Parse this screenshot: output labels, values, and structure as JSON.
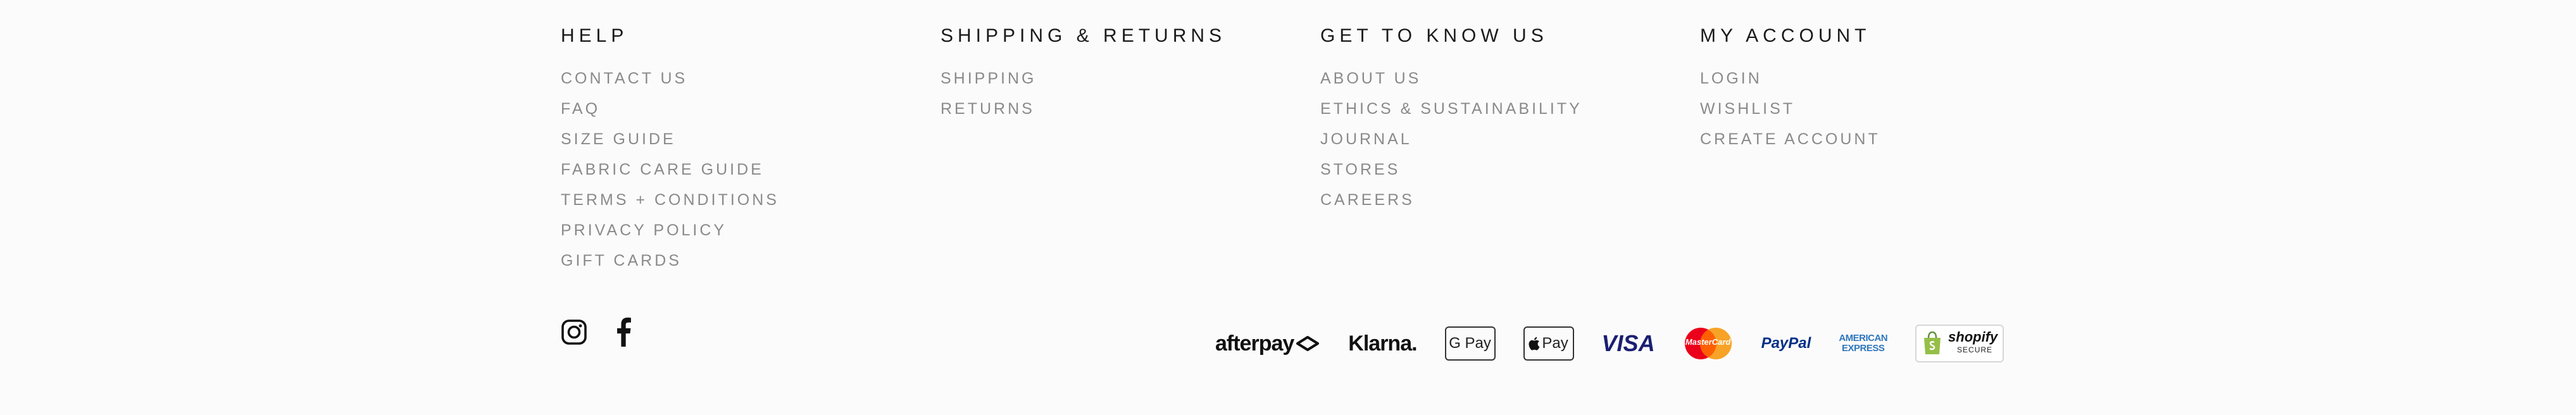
{
  "footer": {
    "columns": [
      {
        "heading": "HELP",
        "links": [
          "CONTACT US",
          "FAQ",
          "SIZE GUIDE",
          "FABRIC CARE GUIDE",
          "TERMS + CONDITIONS",
          "PRIVACY POLICY",
          "GIFT CARDS"
        ]
      },
      {
        "heading": "SHIPPING & RETURNS",
        "links": [
          "SHIPPING",
          "RETURNS"
        ]
      },
      {
        "heading": "GET TO KNOW US",
        "links": [
          "ABOUT US",
          "ETHICS & SUSTAINABILITY",
          "JOURNAL",
          "STORES",
          "CAREERS"
        ]
      },
      {
        "heading": "MY ACCOUNT",
        "links": [
          "LOGIN",
          "WISHLIST",
          "CREATE ACCOUNT"
        ]
      }
    ],
    "social": [
      "instagram-icon",
      "facebook-icon"
    ],
    "payments": {
      "afterpay": "afterpay",
      "klarna": "Klarna.",
      "gpay": "G Pay",
      "applepay": "Pay",
      "visa": "VISA",
      "paypal": "PayPal",
      "amex_line1": "AMERICAN",
      "amex_line2": "EXPRESS",
      "shopify": "shopify",
      "shopify_sub": "SECURE",
      "mastercard": "MasterCard"
    },
    "colors": {
      "heading": "#1a1a1a",
      "link": "#8a8a8a",
      "background": "#fcfbfb",
      "visa": "#1a1f71",
      "mastercard_red": "#eb001b",
      "mastercard_orange": "#f79e1b",
      "paypal_dark": "#003087",
      "paypal_light": "#009cde",
      "amex": "#2e77bc",
      "shopify_green": "#95bf47"
    }
  }
}
